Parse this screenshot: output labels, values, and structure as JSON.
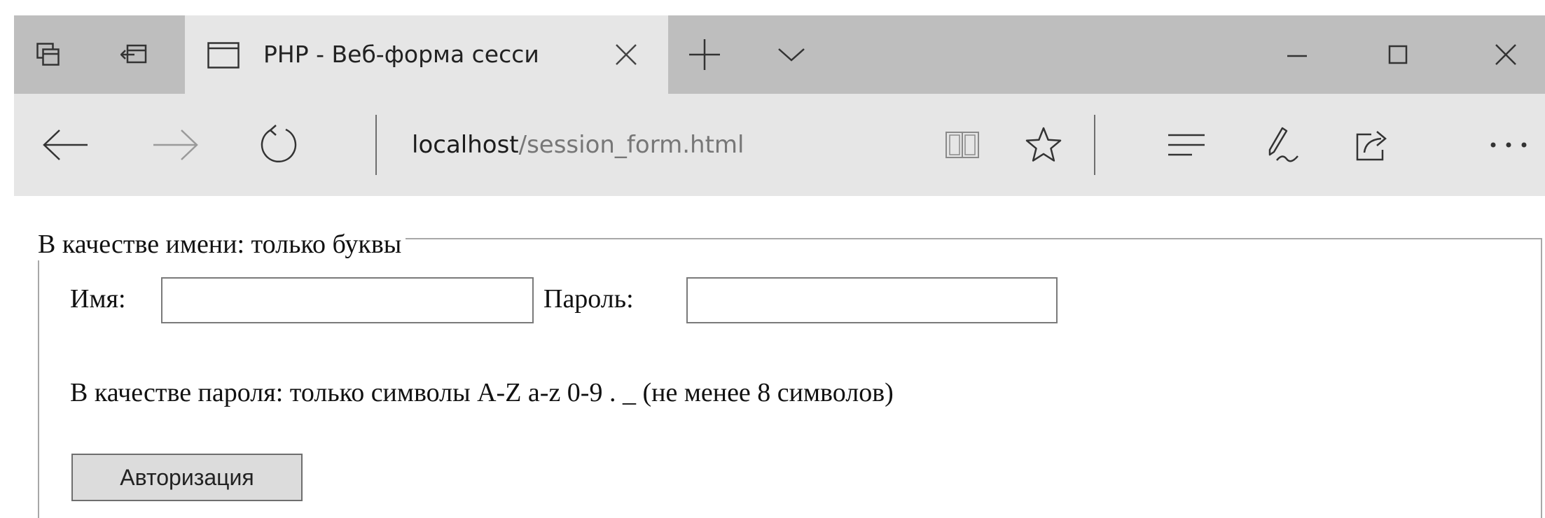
{
  "browser": {
    "tab": {
      "title": "PHP - Веб-форма сесси",
      "page_icon": "page-icon",
      "close_icon": "close-icon"
    },
    "tabstrip_icons": [
      "tab-preview-icon",
      "set-aside-tabs-icon",
      "new-tab-icon",
      "chevron-down-icon"
    ],
    "window_controls": [
      "minimize-icon",
      "maximize-icon",
      "close-icon"
    ],
    "nav_icons": [
      "back-arrow-icon",
      "forward-arrow-icon",
      "refresh-icon"
    ],
    "address": {
      "host": "localhost",
      "path": "/session_form.html"
    },
    "toolbar_icons": [
      "reading-view-icon",
      "favorite-star-icon",
      "hub-icon",
      "web-note-pen-icon",
      "share-icon",
      "more-dots-icon"
    ]
  },
  "form": {
    "legend": "В качестве имени: только буквы",
    "name_label": "Имя:",
    "name_value": "",
    "password_label": "Пароль:",
    "password_value": "",
    "password_hint": "В качестве пароля: только символы A-Z a-z 0-9 . _ (не менее 8 символов)",
    "submit_label": "Авторизация"
  }
}
